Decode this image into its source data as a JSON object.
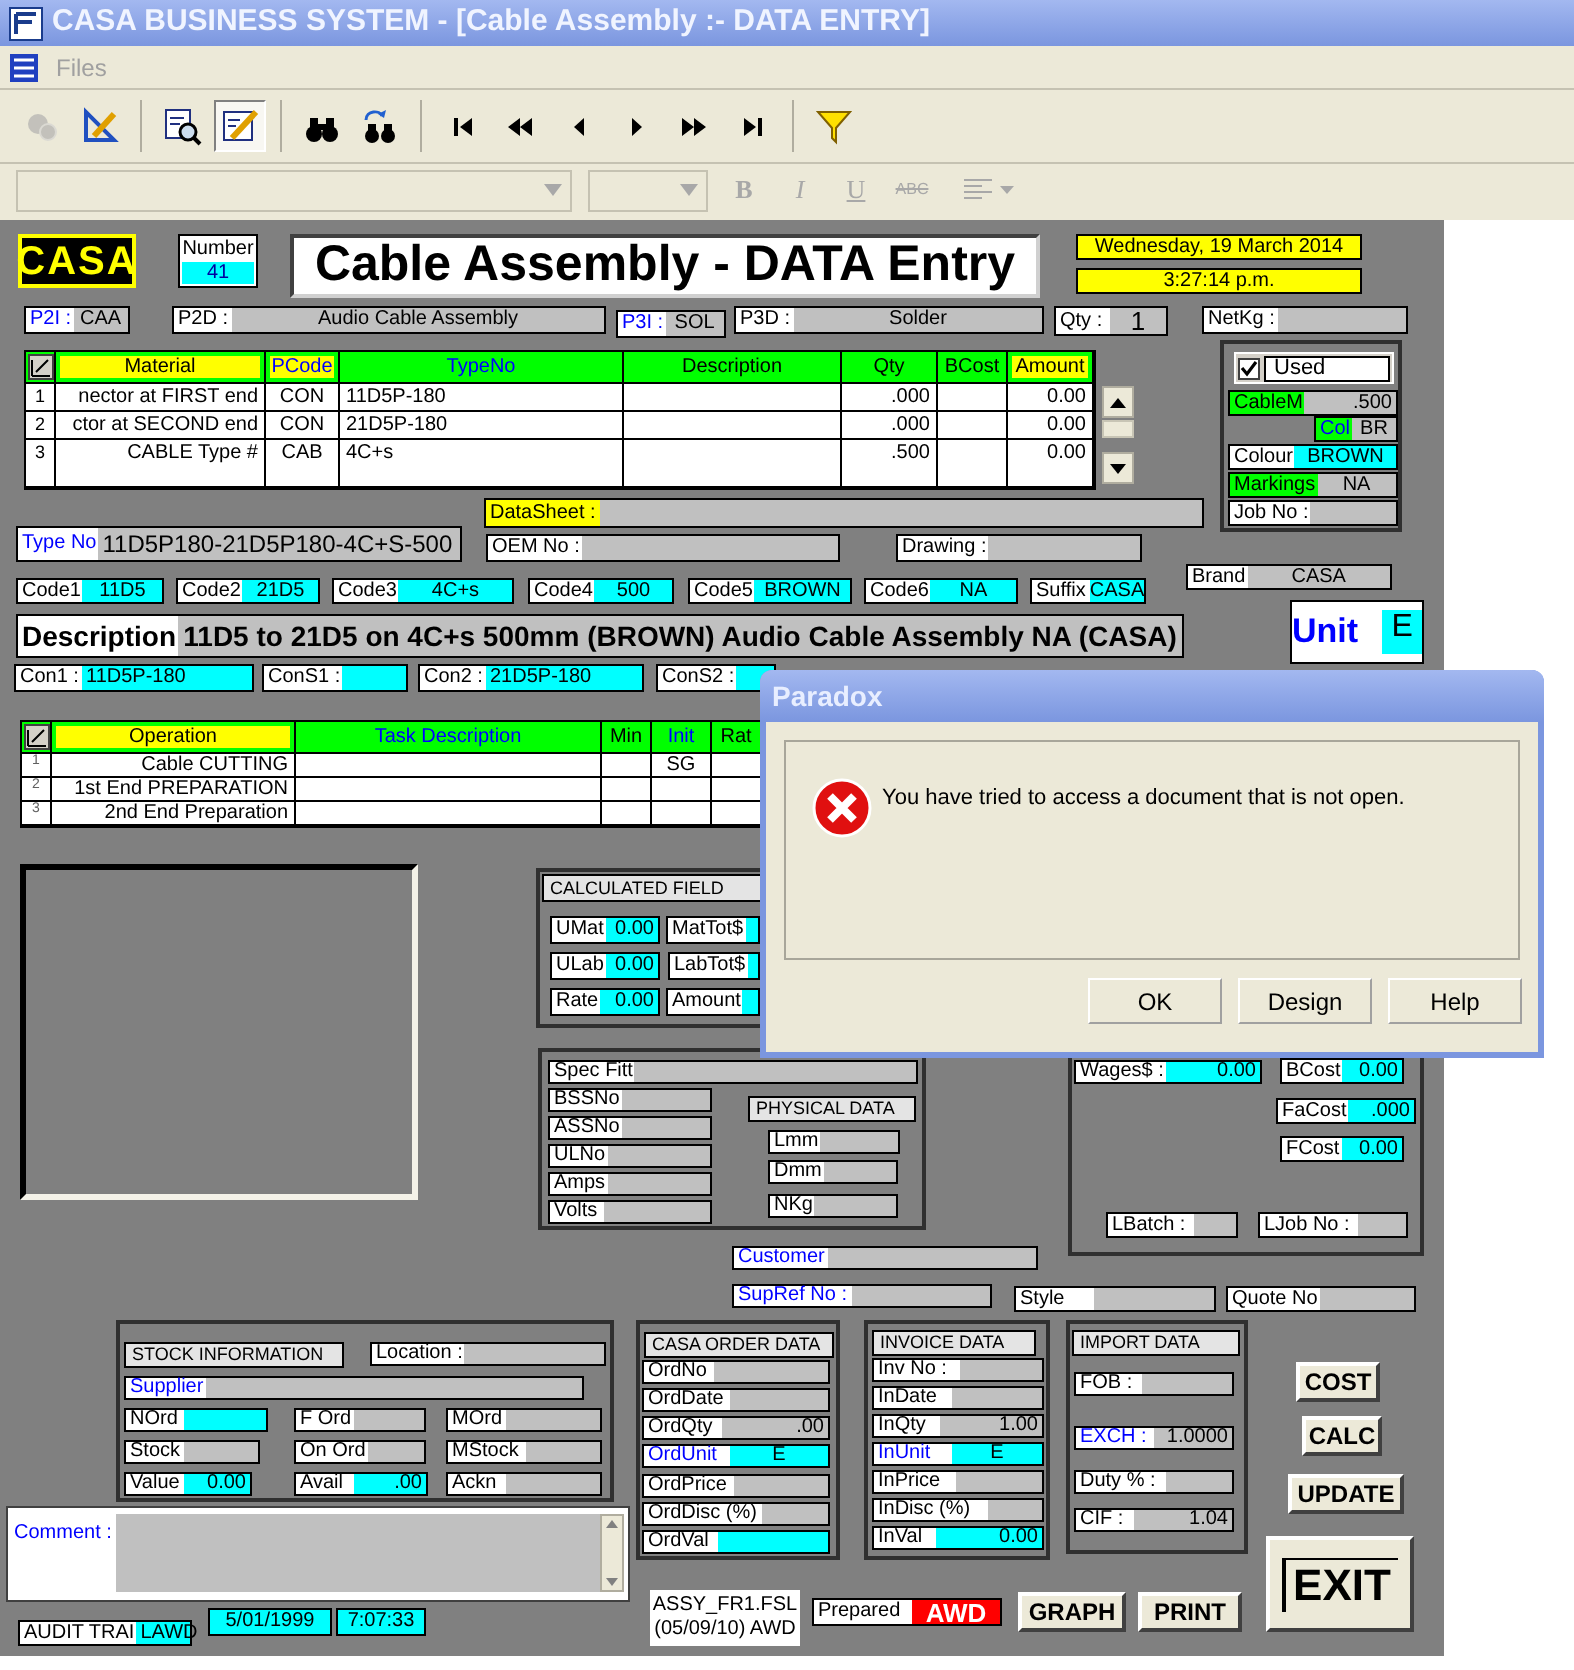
{
  "window": {
    "title": "CASA BUSINESS SYSTEM - [Cable Assembly :-  DATA ENTRY]"
  },
  "menu": [
    {
      "label": "Files",
      "disabled": true
    }
  ],
  "toolbar": [
    {
      "kind": "gear",
      "disabled": true,
      "pressed": false
    },
    {
      "kind": "triangle",
      "disabled": false,
      "pressed": false
    },
    {
      "kind": "search",
      "disabled": false,
      "pressed": false
    },
    {
      "kind": "edit",
      "disabled": false,
      "pressed": true
    },
    {
      "kind": "find",
      "disabled": false,
      "pressed": false
    },
    {
      "kind": "replace",
      "disabled": false,
      "pressed": false
    },
    {
      "kind": "first",
      "disabled": false,
      "pressed": false
    },
    {
      "kind": "prev-page",
      "disabled": false,
      "pressed": false
    },
    {
      "kind": "prev",
      "disabled": false,
      "pressed": false
    },
    {
      "kind": "next",
      "disabled": false,
      "pressed": false
    },
    {
      "kind": "next-page",
      "disabled": false,
      "pressed": false
    },
    {
      "kind": "last",
      "disabled": false,
      "pressed": false
    },
    {
      "kind": "filter",
      "disabled": false,
      "pressed": false
    }
  ],
  "format_toolbar": {
    "disabled": true,
    "buttons": [
      "B",
      "I",
      "U",
      "ABC"
    ]
  },
  "header": {
    "logo": "CASA",
    "number_label": "Number",
    "number": "41",
    "title": "Cable Assembly - DATA Entry",
    "date": "Wednesday, 19 March 2014",
    "time": "3:27:14 p.m."
  },
  "used": {
    "label": "Used",
    "checked": true
  },
  "materials": {
    "columns": [
      "Material",
      "PCode",
      "TypeNo",
      "Description",
      "Qty",
      "BCost",
      "Amount"
    ],
    "rows": [
      {
        "number": "1",
        "material": "nector at FIRST end",
        "pcode": "CON",
        "type_no": "11D5P-180",
        "qty": ".000",
        "amount": "0.00"
      },
      {
        "number": "2",
        "material": "ctor at SECOND end",
        "pcode": "CON",
        "type_no": "21D5P-180",
        "qty": ".000",
        "amount": "0.00"
      },
      {
        "number": "3",
        "material": "CABLE Type #",
        "pcode": "CAB",
        "type_no": "4C+s",
        "qty": ".500",
        "amount": "0.00"
      }
    ]
  },
  "operations": {
    "columns": [
      "Operation",
      "Task Description",
      "Min",
      "Init",
      "Rat"
    ],
    "rows": [
      {
        "number": "1",
        "operation": "Cable CUTTING",
        "init": "SG"
      },
      {
        "number": "2",
        "operation": "1st End PREPARATION"
      },
      {
        "number": "3",
        "operation": "2nd End Preparation"
      }
    ]
  },
  "headings": [
    "CALCULATED FIELD",
    "PHYSICAL DATA",
    "STOCK INFORMATION",
    "CASA ORDER  DATA",
    "INVOICE DATA",
    "IMPORT DATA"
  ],
  "fields": [
    {
      "label": "P2I :",
      "value": "CAA"
    },
    {
      "label": "P2D :",
      "value": "Audio Cable Assembly"
    },
    {
      "label": "P3I :",
      "value": "SOL"
    },
    {
      "label": "P3D :",
      "value": "Solder"
    },
    {
      "label": "Qty :",
      "value": "1"
    },
    {
      "label": "NetKg :"
    },
    {
      "label": "CableM",
      "value": ".500"
    },
    {
      "label": "Col",
      "value": "BR"
    },
    {
      "label": "Colour",
      "value": "BROWN"
    },
    {
      "label": "Markings",
      "value": "NA"
    },
    {
      "label": "Job No :"
    },
    {
      "label": "DataSheet :"
    },
    {
      "label": "Type No",
      "value": "11D5P180-21D5P180-4C+S-500"
    },
    {
      "label": "OEM No :"
    },
    {
      "label": "Drawing :"
    },
    {
      "label": "Brand",
      "value": "CASA"
    },
    {
      "label": "Code1",
      "value": "11D5"
    },
    {
      "label": "Code2",
      "value": "21D5"
    },
    {
      "label": "Code3",
      "value": "4C+s"
    },
    {
      "label": "Code4",
      "value": "500"
    },
    {
      "label": "Code5",
      "value": "BROWN"
    },
    {
      "label": "Code6",
      "value": "NA"
    },
    {
      "label": "Suffix",
      "value": "CASA"
    },
    {
      "label": "Description",
      "value": "11D5 to 21D5 on 4C+s 500mm (BROWN) Audio Cable Assembly NA (CASA)"
    },
    {
      "label": "Unit",
      "value": "E"
    },
    {
      "label": "Con1 :",
      "value": "11D5P-180"
    },
    {
      "label": "ConS1 :"
    },
    {
      "label": "Con2 :",
      "value": "21D5P-180"
    },
    {
      "label": "ConS2 :"
    },
    {
      "label": "UMat",
      "value": "0.00"
    },
    {
      "label": "ULab",
      "value": "0.00"
    },
    {
      "label": "Rate",
      "value": "0.00"
    },
    {
      "label": "MatTot$"
    },
    {
      "label": "LabTot$"
    },
    {
      "label": "Amount"
    },
    {
      "label": "Spec Fitt"
    },
    {
      "label": "BSSNo"
    },
    {
      "label": "ASSNo"
    },
    {
      "label": "ULNo"
    },
    {
      "label": "Amps"
    },
    {
      "label": "Volts"
    },
    {
      "label": "Lmm"
    },
    {
      "label": "Dmm"
    },
    {
      "label": "NKg"
    },
    {
      "label": "Wages$ :",
      "value": "0.00"
    },
    {
      "label": "BCost",
      "value": "0.00"
    },
    {
      "label": "FaCost",
      "value": ".000"
    },
    {
      "label": "FCost",
      "value": "0.00"
    },
    {
      "label": "LBatch :"
    },
    {
      "label": "LJob No :"
    },
    {
      "label": "Customer"
    },
    {
      "label": "SupRef No :"
    },
    {
      "label": "Style"
    },
    {
      "label": "Quote No"
    },
    {
      "label": "Location :"
    },
    {
      "label": "Supplier"
    },
    {
      "label": "NOrd"
    },
    {
      "label": "F Ord"
    },
    {
      "label": "MOrd"
    },
    {
      "label": "Stock"
    },
    {
      "label": "On Ord"
    },
    {
      "label": "MStock"
    },
    {
      "label": "Value",
      "value": "0.00"
    },
    {
      "label": "Avail",
      "value": ".00"
    },
    {
      "label": "Ackn"
    },
    {
      "label": "OrdNo"
    },
    {
      "label": "OrdDate"
    },
    {
      "label": "OrdQty",
      "value": ".00"
    },
    {
      "label": "OrdUnit",
      "value": "E"
    },
    {
      "label": "OrdPrice"
    },
    {
      "label": "OrdDisc (%)"
    },
    {
      "label": "OrdVal"
    },
    {
      "label": "Inv No :"
    },
    {
      "label": "InDate"
    },
    {
      "label": "InQty",
      "value": "1.00"
    },
    {
      "label": "InUnit",
      "value": "E"
    },
    {
      "label": "InPrice"
    },
    {
      "label": "InDisc (%)"
    },
    {
      "label": "InVal",
      "value": "0.00"
    },
    {
      "label": "FOB :"
    },
    {
      "label": "EXCH :",
      "value": "1.0000"
    },
    {
      "label": "Duty % :"
    },
    {
      "label": "CIF :",
      "value": "1.04"
    },
    {
      "label": "AUDIT TRAI",
      "value": "LAWD"
    },
    {
      "value": "5/01/1999"
    },
    {
      "value": "7:07:33"
    },
    {
      "label": "Prepared",
      "value": "AWD"
    }
  ],
  "comment": {
    "label": "Comment :"
  },
  "file_info": [
    "ASSY_FR1.FSL",
    "(05/09/10) AWD"
  ],
  "buttons": [
    "COST",
    "CALC",
    "UPDATE",
    "GRAPH",
    "PRINT",
    "EXIT"
  ],
  "dialog": {
    "title": "Paradox",
    "message": "You have tried to access a document that is not open.",
    "buttons": [
      "OK",
      "Design",
      "Help"
    ]
  }
}
